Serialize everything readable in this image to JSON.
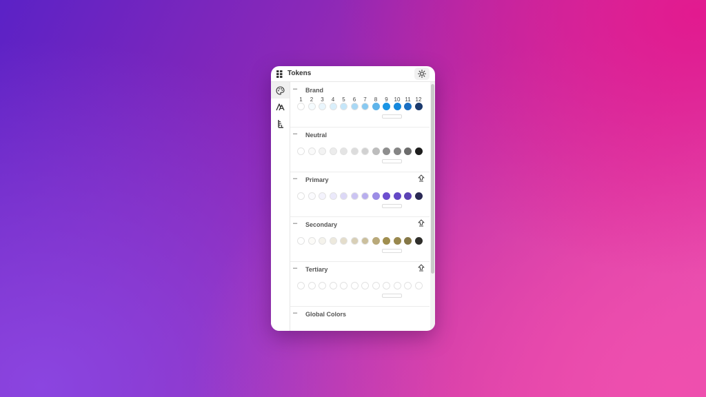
{
  "header": {
    "title": "Tokens",
    "theme_icon": "sun-icon",
    "app_icon": "grid-icon"
  },
  "rail": {
    "tabs": [
      {
        "icon": "palette-icon",
        "active": true
      },
      {
        "icon": "typography-icon",
        "active": false
      },
      {
        "icon": "measure-icon",
        "active": false
      }
    ]
  },
  "scale_numbers": [
    "1",
    "2",
    "3",
    "4",
    "5",
    "6",
    "7",
    "8",
    "9",
    "10",
    "11",
    "12"
  ],
  "sections": [
    {
      "title": "Brand",
      "collapse": "–",
      "export": false,
      "show_numbers": true,
      "colors": [
        "#ffffff",
        "#f5fbfe",
        "#eaf6fd",
        "#d9effb",
        "#c5e6f9",
        "#a9d8f5",
        "#88c9f1",
        "#5fb4ea",
        "#1b95e4",
        "#1688dc",
        "#1a6fc2",
        "#1c3b6e"
      ]
    },
    {
      "title": "Neutral",
      "collapse": "–",
      "export": false,
      "show_numbers": false,
      "colors": [
        "#ffffff",
        "#fafafa",
        "#f3f3f3",
        "#ececec",
        "#e4e4e4",
        "#dcdcdc",
        "#d1d1d1",
        "#bdbdbd",
        "#8e8e8e",
        "#858585",
        "#6c6c6c",
        "#1e1e1e"
      ]
    },
    {
      "title": "Primary",
      "collapse": "–",
      "export": true,
      "show_numbers": false,
      "colors": [
        "#ffffff",
        "#fbfbfe",
        "#f4f3fd",
        "#ebe9fb",
        "#dcd8f7",
        "#cbc4f3",
        "#b8aeee",
        "#9c8de6",
        "#6c4fcf",
        "#6448c6",
        "#5c43b5",
        "#2b2a55"
      ]
    },
    {
      "title": "Secondary",
      "collapse": "–",
      "export": true,
      "show_numbers": false,
      "colors": [
        "#ffffff",
        "#fcfbf8",
        "#f5f3ec",
        "#ede9dd",
        "#e4ddcb",
        "#d8cfb6",
        "#cbbf9c",
        "#b9a97a",
        "#a08e4f",
        "#99884e",
        "#857747",
        "#2f2e2b"
      ]
    },
    {
      "title": "Tertiary",
      "collapse": "–",
      "export": true,
      "show_numbers": false,
      "colors": [
        "#ffffff",
        "#ffffff",
        "#ffffff",
        "#ffffff",
        "#ffffff",
        "#ffffff",
        "#ffffff",
        "#ffffff",
        "#ffffff",
        "#ffffff",
        "#ffffff",
        "#ffffff"
      ]
    }
  ],
  "global": {
    "title": "Global Colors",
    "collapse": "–"
  }
}
